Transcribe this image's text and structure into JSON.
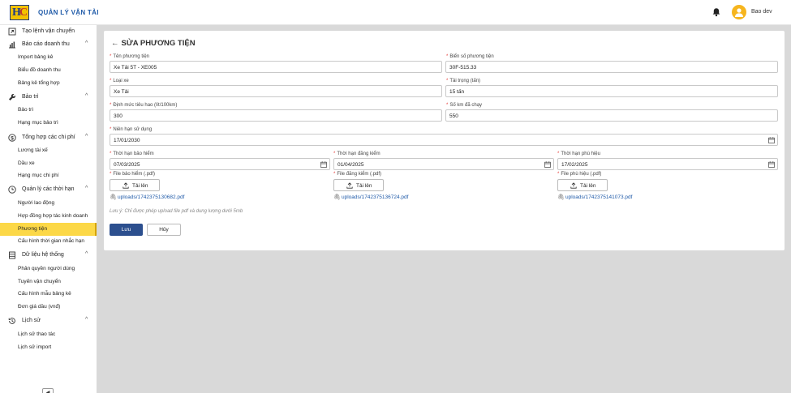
{
  "app": {
    "title": "QUẢN LÝ VẬN TẢI",
    "logo_text": "HC"
  },
  "user": {
    "name": "Bao dev"
  },
  "sidebar": {
    "top_item": "Tạo lệnh vận chuyển",
    "groups": [
      {
        "label": "Báo cáo doanh thu",
        "items": [
          "Import bảng kê",
          "Biểu đồ doanh thu",
          "Bảng kê tổng hợp"
        ]
      },
      {
        "label": "Bảo trì",
        "items": [
          "Bảo trì",
          "Hạng mục bảo trì"
        ]
      },
      {
        "label": "Tổng hợp các chi phí",
        "items": [
          "Lương tài xế",
          "Dầu xe",
          "Hạng mục chi phí"
        ]
      },
      {
        "label": "Quản lý các thời hạn",
        "items": [
          "Người lao động",
          "Hợp đồng hợp tác kinh doanh",
          "Phương tiện",
          "Cấu hình thời gian nhắc hạn"
        ]
      },
      {
        "label": "Dữ liệu hệ thống",
        "items": [
          "Phân quyền người dùng",
          "Tuyến vận chuyển",
          "Cấu hình mẫu bảng kê",
          "Đơn giá dầu (vnđ)"
        ]
      },
      {
        "label": "Lịch sử",
        "items": [
          "Lịch sử thao tác",
          "Lịch sử import"
        ]
      }
    ],
    "active_item": "Phương tiện"
  },
  "page": {
    "title": "SỬA PHƯƠNG TIỆN"
  },
  "form": {
    "vehicle_name": {
      "label": "Tên phương tiện",
      "value": "Xe Tải 5T - XE005"
    },
    "plate": {
      "label": "Biển số phương tiện",
      "value": "30F-515.33"
    },
    "vehicle_type": {
      "label": "Loại xe",
      "value": "Xe Tải"
    },
    "load": {
      "label": "Tải trọng (tấn)",
      "value": "15 tấn"
    },
    "fuel_norm": {
      "label": "Định mức tiêu hao (lít/100km)",
      "value": "300"
    },
    "km": {
      "label": "Số km đã chạy",
      "value": "550"
    },
    "service_life": {
      "label": "Niên hạn sử dụng",
      "value": "17/01/2030"
    },
    "insurance_exp": {
      "label": "Thời hạn bảo hiểm",
      "value": "07/03/2025"
    },
    "inspection_exp": {
      "label": "Thời hạn đăng kiểm",
      "value": "01/04/2025"
    },
    "badge_exp": {
      "label": "Thời hạn phù hiệu",
      "value": "17/02/2025"
    },
    "insurance_file": {
      "label": "File bảo hiểm (.pdf)",
      "button": "Tải lên",
      "file": "uploads/1742375130682.pdf"
    },
    "inspection_file": {
      "label": "File đăng kiểm (.pdf)",
      "button": "Tải lên",
      "file": "uploads/1742375136724.pdf"
    },
    "badge_file": {
      "label": "File phù hiệu (.pdf)",
      "button": "Tải lên",
      "file": "uploads/1742375141073.pdf"
    },
    "note": "Lưu ý: Chỉ được phép upload file pdf và dung lượng dưới 5mb",
    "save": "Lưu",
    "cancel": "Hủy"
  },
  "colors": {
    "accent": "#2c4f8e",
    "active_bg": "#fcd847",
    "link": "#1f5aa8",
    "required": "#e53935"
  }
}
